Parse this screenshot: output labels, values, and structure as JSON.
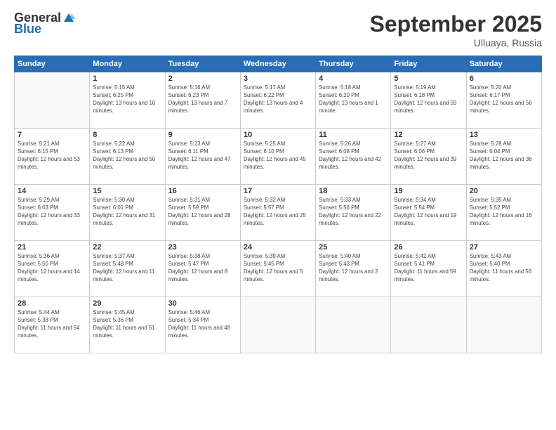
{
  "header": {
    "logo_general": "General",
    "logo_blue": "Blue",
    "month": "September 2025",
    "location": "Ulluaya, Russia"
  },
  "weekdays": [
    "Sunday",
    "Monday",
    "Tuesday",
    "Wednesday",
    "Thursday",
    "Friday",
    "Saturday"
  ],
  "weeks": [
    [
      {
        "day": "",
        "sunrise": "",
        "sunset": "",
        "daylight": ""
      },
      {
        "day": "1",
        "sunrise": "Sunrise: 5:15 AM",
        "sunset": "Sunset: 6:25 PM",
        "daylight": "Daylight: 13 hours and 10 minutes."
      },
      {
        "day": "2",
        "sunrise": "Sunrise: 5:16 AM",
        "sunset": "Sunset: 6:23 PM",
        "daylight": "Daylight: 13 hours and 7 minutes."
      },
      {
        "day": "3",
        "sunrise": "Sunrise: 5:17 AM",
        "sunset": "Sunset: 6:22 PM",
        "daylight": "Daylight: 13 hours and 4 minutes."
      },
      {
        "day": "4",
        "sunrise": "Sunrise: 5:18 AM",
        "sunset": "Sunset: 6:20 PM",
        "daylight": "Daylight: 13 hours and 1 minute."
      },
      {
        "day": "5",
        "sunrise": "Sunrise: 5:19 AM",
        "sunset": "Sunset: 6:18 PM",
        "daylight": "Daylight: 12 hours and 59 minutes."
      },
      {
        "day": "6",
        "sunrise": "Sunrise: 5:20 AM",
        "sunset": "Sunset: 6:17 PM",
        "daylight": "Daylight: 12 hours and 56 minutes."
      }
    ],
    [
      {
        "day": "7",
        "sunrise": "Sunrise: 5:21 AM",
        "sunset": "Sunset: 6:15 PM",
        "daylight": "Daylight: 12 hours and 53 minutes."
      },
      {
        "day": "8",
        "sunrise": "Sunrise: 5:22 AM",
        "sunset": "Sunset: 6:13 PM",
        "daylight": "Daylight: 12 hours and 50 minutes."
      },
      {
        "day": "9",
        "sunrise": "Sunrise: 5:23 AM",
        "sunset": "Sunset: 6:11 PM",
        "daylight": "Daylight: 12 hours and 47 minutes."
      },
      {
        "day": "10",
        "sunrise": "Sunrise: 5:25 AM",
        "sunset": "Sunset: 6:10 PM",
        "daylight": "Daylight: 12 hours and 45 minutes."
      },
      {
        "day": "11",
        "sunrise": "Sunrise: 5:26 AM",
        "sunset": "Sunset: 6:08 PM",
        "daylight": "Daylight: 12 hours and 42 minutes."
      },
      {
        "day": "12",
        "sunrise": "Sunrise: 5:27 AM",
        "sunset": "Sunset: 6:06 PM",
        "daylight": "Daylight: 12 hours and 39 minutes."
      },
      {
        "day": "13",
        "sunrise": "Sunrise: 5:28 AM",
        "sunset": "Sunset: 6:04 PM",
        "daylight": "Daylight: 12 hours and 36 minutes."
      }
    ],
    [
      {
        "day": "14",
        "sunrise": "Sunrise: 5:29 AM",
        "sunset": "Sunset: 6:03 PM",
        "daylight": "Daylight: 12 hours and 33 minutes."
      },
      {
        "day": "15",
        "sunrise": "Sunrise: 5:30 AM",
        "sunset": "Sunset: 6:01 PM",
        "daylight": "Daylight: 12 hours and 31 minutes."
      },
      {
        "day": "16",
        "sunrise": "Sunrise: 5:31 AM",
        "sunset": "Sunset: 5:59 PM",
        "daylight": "Daylight: 12 hours and 28 minutes."
      },
      {
        "day": "17",
        "sunrise": "Sunrise: 5:32 AM",
        "sunset": "Sunset: 5:57 PM",
        "daylight": "Daylight: 12 hours and 25 minutes."
      },
      {
        "day": "18",
        "sunrise": "Sunrise: 5:33 AM",
        "sunset": "Sunset: 5:56 PM",
        "daylight": "Daylight: 12 hours and 22 minutes."
      },
      {
        "day": "19",
        "sunrise": "Sunrise: 5:34 AM",
        "sunset": "Sunset: 5:54 PM",
        "daylight": "Daylight: 12 hours and 19 minutes."
      },
      {
        "day": "20",
        "sunrise": "Sunrise: 5:35 AM",
        "sunset": "Sunset: 5:52 PM",
        "daylight": "Daylight: 12 hours and 16 minutes."
      }
    ],
    [
      {
        "day": "21",
        "sunrise": "Sunrise: 5:36 AM",
        "sunset": "Sunset: 5:50 PM",
        "daylight": "Daylight: 12 hours and 14 minutes."
      },
      {
        "day": "22",
        "sunrise": "Sunrise: 5:37 AM",
        "sunset": "Sunset: 5:48 PM",
        "daylight": "Daylight: 12 hours and 11 minutes."
      },
      {
        "day": "23",
        "sunrise": "Sunrise: 5:38 AM",
        "sunset": "Sunset: 5:47 PM",
        "daylight": "Daylight: 12 hours and 8 minutes."
      },
      {
        "day": "24",
        "sunrise": "Sunrise: 5:39 AM",
        "sunset": "Sunset: 5:45 PM",
        "daylight": "Daylight: 12 hours and 5 minutes."
      },
      {
        "day": "25",
        "sunrise": "Sunrise: 5:40 AM",
        "sunset": "Sunset: 5:43 PM",
        "daylight": "Daylight: 12 hours and 2 minutes."
      },
      {
        "day": "26",
        "sunrise": "Sunrise: 5:42 AM",
        "sunset": "Sunset: 5:41 PM",
        "daylight": "Daylight: 11 hours and 59 minutes."
      },
      {
        "day": "27",
        "sunrise": "Sunrise: 5:43 AM",
        "sunset": "Sunset: 5:40 PM",
        "daylight": "Daylight: 11 hours and 56 minutes."
      }
    ],
    [
      {
        "day": "28",
        "sunrise": "Sunrise: 5:44 AM",
        "sunset": "Sunset: 5:38 PM",
        "daylight": "Daylight: 11 hours and 54 minutes."
      },
      {
        "day": "29",
        "sunrise": "Sunrise: 5:45 AM",
        "sunset": "Sunset: 5:36 PM",
        "daylight": "Daylight: 11 hours and 51 minutes."
      },
      {
        "day": "30",
        "sunrise": "Sunrise: 5:46 AM",
        "sunset": "Sunset: 5:34 PM",
        "daylight": "Daylight: 11 hours and 48 minutes."
      },
      {
        "day": "",
        "sunrise": "",
        "sunset": "",
        "daylight": ""
      },
      {
        "day": "",
        "sunrise": "",
        "sunset": "",
        "daylight": ""
      },
      {
        "day": "",
        "sunrise": "",
        "sunset": "",
        "daylight": ""
      },
      {
        "day": "",
        "sunrise": "",
        "sunset": "",
        "daylight": ""
      }
    ]
  ]
}
